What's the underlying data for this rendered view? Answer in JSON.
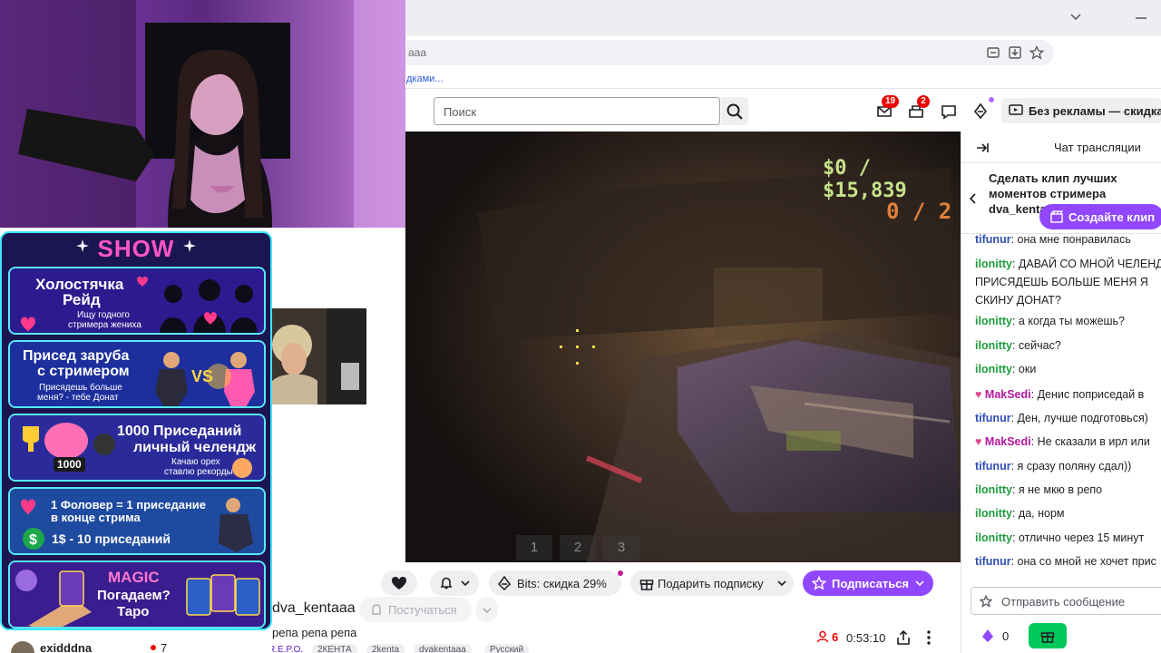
{
  "browser": {
    "url": "aaa",
    "bookmark_text": "дками..."
  },
  "topnav": {
    "search_placeholder": "Поиск",
    "notifications_count": "19",
    "inbox_count": "2",
    "adfree_label": "Без рекламы — скидка"
  },
  "video": {
    "hud_money": "$0 / $15,839",
    "hud_count": "0 / 2",
    "hotbar": [
      "1",
      "2",
      "3"
    ]
  },
  "overlay": {
    "title": "SHOW",
    "cards": [
      {
        "line1": "Холостячка",
        "line2": "Рейд",
        "line3": "Ищу годного",
        "line4": "стримера жениха",
        "color": "#2b1b8f"
      },
      {
        "line1": "Присед заруба",
        "line2": "с стримером",
        "line3": "Присядешь больше",
        "line4": "меня? - тебе Донат",
        "color": "#1d2f9c"
      },
      {
        "line1": "1000 Приседаний",
        "line2": "личный челендж",
        "line3": "Качаю орех",
        "line4": "ставлю рекорды",
        "badge": "1000",
        "color": "#2a2a9a"
      },
      {
        "line1": "1 Фоловер = 1 приседание",
        "line2": "в конце стрима",
        "line3": "1$ - 10 приседаний",
        "color": "#1e4ba0"
      },
      {
        "line1": "MAGIC",
        "line2": "Погадаем?",
        "line3": "Таро",
        "color": "#3a1d8e"
      }
    ]
  },
  "channel": {
    "name": "dva_kentaaa",
    "knock_label": "Постучаться",
    "title": "репа репа репа",
    "viewers": "6",
    "uptime": "0:53:10",
    "tags": [
      "R.E.P.O.",
      "2КЕНТА",
      "2kenta",
      "dvakentaaa",
      "Русский"
    ]
  },
  "actions": {
    "bits_label": "Bits: скидка 29%",
    "gift_label": "Подарить подписку",
    "subscribe_label": "Подписаться"
  },
  "sidebar_user": {
    "name": "exidddna",
    "count": "7"
  },
  "chat": {
    "title": "Чат трансляции",
    "promo_text": "Сделать клип лучших моментов стримера dva_kentaaa",
    "create_clip_label": "Создайте клип",
    "input_placeholder": "Отправить сообщение",
    "points": "0",
    "messages": [
      {
        "user": "tifunur",
        "text": ": она мне понравилась",
        "color": "#2e4db3"
      },
      {
        "user": "ilonitty",
        "text": ": ДАВАЙ СО МНОЙ ЧЕЛЕНДЖ ПРИСЯДЕШЬ БОЛЬШЕ МЕНЯ Я СКИНУ ДОНАТ?",
        "color": "#1e9c3c",
        "multi": true
      },
      {
        "user": "ilonitty",
        "text": ": а когда ты можешь?",
        "color": "#1e9c3c"
      },
      {
        "user": "ilonitty",
        "text": ": сейчас?",
        "color": "#1e9c3c"
      },
      {
        "user": "ilonitty",
        "text": ": оки",
        "color": "#1e9c3c"
      },
      {
        "user": "MakSedi",
        "text": ": Денис поприседай в",
        "color": "#b5179e",
        "heart": true
      },
      {
        "user": "tifunur",
        "text": ": Ден, лучше подготовься)",
        "color": "#2e4db3"
      },
      {
        "user": "MakSedi",
        "text": ": Не сказали в ирл или",
        "color": "#b5179e",
        "heart": true
      },
      {
        "user": "tifunur",
        "text": ": я сразу поляну сдал))",
        "color": "#2e4db3"
      },
      {
        "user": "ilonitty",
        "text": ": я не мкю в репо",
        "color": "#1e9c3c"
      },
      {
        "user": "ilonitty",
        "text": ": да, норм",
        "color": "#1e9c3c"
      },
      {
        "user": "ilonitty",
        "text": ": отлично через 15 минут",
        "color": "#1e9c3c"
      },
      {
        "user": "tifunur",
        "text": ": она со мной не хочет прис",
        "color": "#2e4db3"
      }
    ]
  }
}
